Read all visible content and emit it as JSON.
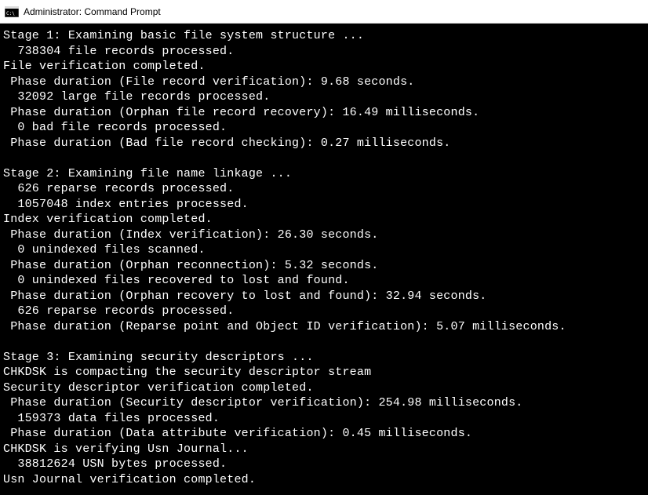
{
  "window": {
    "title": "Administrator: Command Prompt"
  },
  "output": {
    "lines": [
      "Stage 1: Examining basic file system structure ...",
      "  738304 file records processed.",
      "File verification completed.",
      " Phase duration (File record verification): 9.68 seconds.",
      "  32092 large file records processed.",
      " Phase duration (Orphan file record recovery): 16.49 milliseconds.",
      "  0 bad file records processed.",
      " Phase duration (Bad file record checking): 0.27 milliseconds.",
      "",
      "Stage 2: Examining file name linkage ...",
      "  626 reparse records processed.",
      "  1057048 index entries processed.",
      "Index verification completed.",
      " Phase duration (Index verification): 26.30 seconds.",
      "  0 unindexed files scanned.",
      " Phase duration (Orphan reconnection): 5.32 seconds.",
      "  0 unindexed files recovered to lost and found.",
      " Phase duration (Orphan recovery to lost and found): 32.94 seconds.",
      "  626 reparse records processed.",
      " Phase duration (Reparse point and Object ID verification): 5.07 milliseconds.",
      "",
      "Stage 3: Examining security descriptors ...",
      "CHKDSK is compacting the security descriptor stream",
      "Security descriptor verification completed.",
      " Phase duration (Security descriptor verification): 254.98 milliseconds.",
      "  159373 data files processed.",
      " Phase duration (Data attribute verification): 0.45 milliseconds.",
      "CHKDSK is verifying Usn Journal...",
      "  38812624 USN bytes processed.",
      "Usn Journal verification completed."
    ]
  }
}
